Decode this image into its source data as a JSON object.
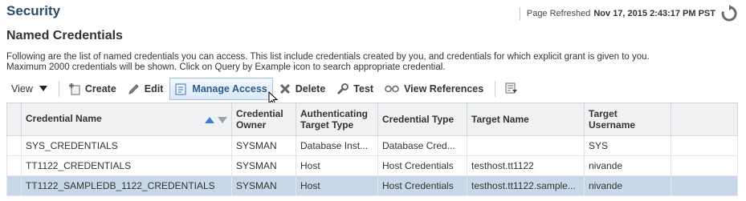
{
  "header": {
    "title": "Security",
    "refresh_label": "Page Refreshed",
    "refresh_time": "Nov 17, 2015 2:43:17 PM PST"
  },
  "section": {
    "title": "Named Credentials",
    "description_1": "Following are the list of named credentials you can access. This list include credentials created by you, and credentials for which explicit grant is given to you.",
    "description_2": "Maximum 2000 credentials will be shown. Click on Query by Example icon to search appropriate credential."
  },
  "toolbar": {
    "view": "View",
    "create": "Create",
    "edit": "Edit",
    "manage_access": "Manage Access",
    "delete": "Delete",
    "test": "Test",
    "view_references": "View References",
    "icons": [
      "dropdown-triangle-icon",
      "create-icon",
      "pencil-icon",
      "manage-access-icon",
      "delete-x-icon",
      "wrench-icon",
      "glasses-icon",
      "query-by-example-icon"
    ]
  },
  "table": {
    "columns": [
      "Credential Name",
      "Credential Owner",
      "Authenticating Target Type",
      "Credential Type",
      "Target Name",
      "Target Username"
    ],
    "rows": [
      [
        "SYS_CREDENTIALS",
        "SYSMAN",
        "Database Inst...",
        "Database Cred...",
        "",
        "SYS"
      ],
      [
        "TT1122_CREDENTIALS",
        "SYSMAN",
        "Host",
        "Host Credentials",
        "testhost.tt1122",
        "nivande"
      ],
      [
        "TT1122_SAMPLEDB_1122_CREDENTIALS",
        "SYSMAN",
        "Host",
        "Host Credentials",
        "testhost.tt1122.sample...",
        "nivande"
      ]
    ],
    "selected_row": 2
  },
  "colors": {
    "title": "#2a4c6b",
    "header_bg": "#f0f1f3",
    "selected_row": "#c8d8e8",
    "sort_up": "#3b7dd8",
    "sort_down": "#9aa3ad"
  }
}
